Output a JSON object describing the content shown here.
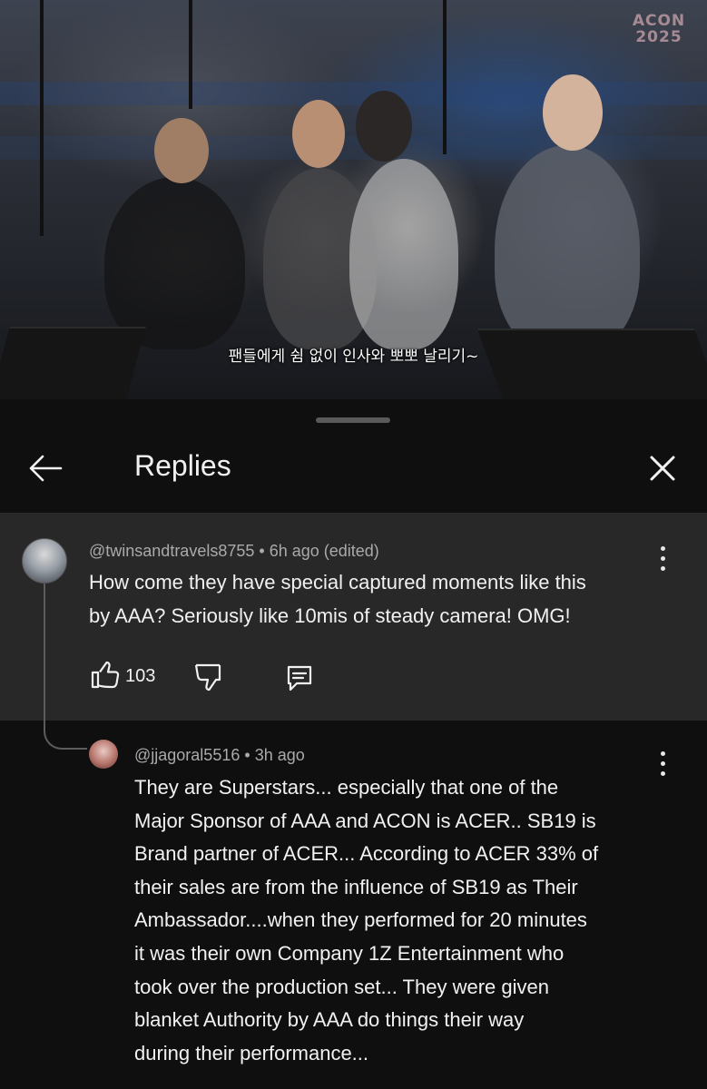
{
  "video": {
    "subtitle": "팬들에게 쉼 없이 인사와 뽀뽀 날리기~",
    "watermark_line1": "ACON",
    "watermark_line2": "2025"
  },
  "sheet": {
    "title": "Replies",
    "back_icon": "arrow-left-icon",
    "close_icon": "close-icon"
  },
  "comments": [
    {
      "author": "@twinsandtravels8755",
      "time": "6h ago (edited)",
      "lines": [
        "How come they have special captured moments like this",
        "by AAA? Seriously like 10mis of steady camera! OMG!"
      ],
      "likes": "103"
    },
    {
      "author": "@jjagoral5516",
      "time": "3h ago",
      "lines": [
        "They are Superstars... especially that one of the",
        "Major Sponsor of AAA and ACON is ACER.. SB19 is",
        "Brand partner of ACER... According to ACER 33% of",
        "their sales are from the influence of SB19 as Their",
        "Ambassador....when they performed for 20 minutes",
        "it was their own Company 1Z Entertainment who",
        "took over the production set... They were given",
        "blanket Authority by AAA do things their way",
        "during their performance..."
      ]
    }
  ],
  "colors": {
    "background": "#0f0f0f",
    "highlight_comment_bg": "#282828",
    "meta_text": "#aaaaaa",
    "text": "#f1f1f1"
  }
}
